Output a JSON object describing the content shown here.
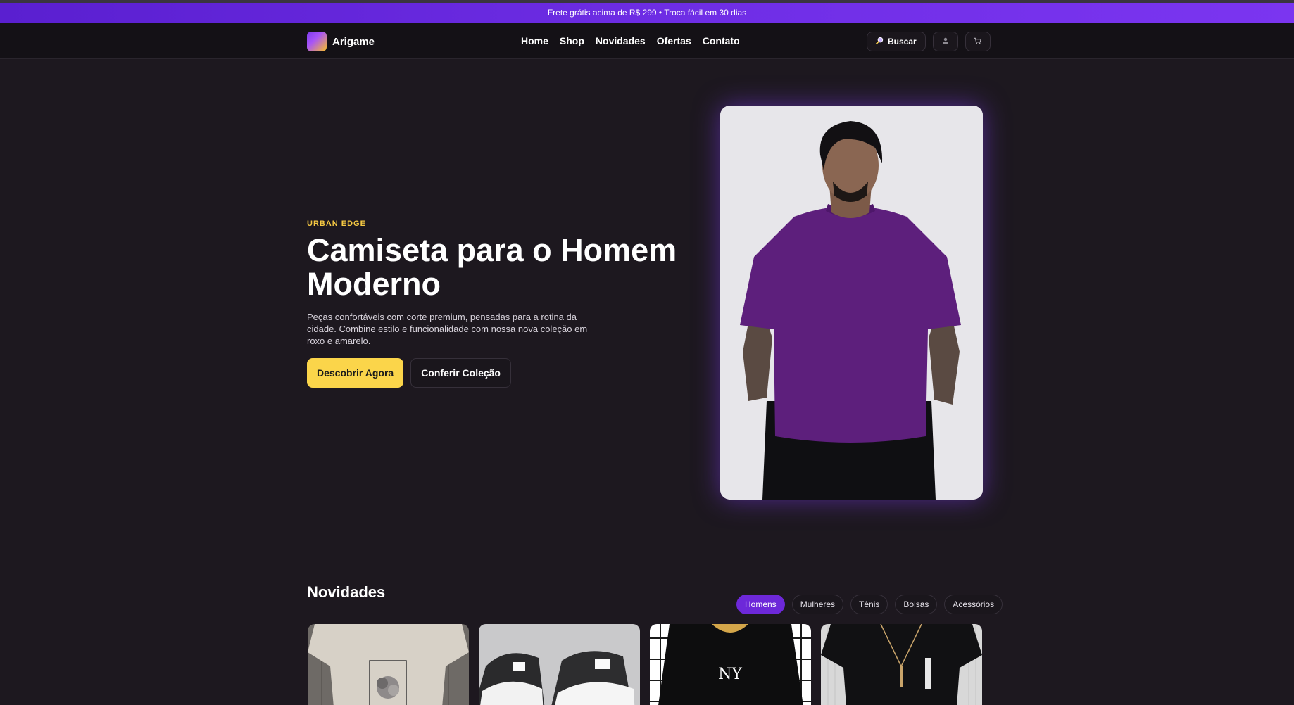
{
  "promo": {
    "text": "Frete grátis acima de R$ 299 • Troca fácil em 30 dias"
  },
  "brand": {
    "name": "Arigame"
  },
  "nav": {
    "links": [
      "Home",
      "Shop",
      "Novidades",
      "Ofertas",
      "Contato"
    ],
    "search_label": "Buscar",
    "icons": [
      "search-icon",
      "user-icon",
      "cart-icon"
    ]
  },
  "hero": {
    "eyebrow": "URBAN EDGE",
    "title": "Camiseta para o Homem Moderno",
    "description": "Peças confortáveis com corte premium, pensadas para a rotina da cidade. Combine estilo e funcionalidade com nossa nova coleção em roxo e amarelo.",
    "primary_cta": "Descobrir Agora",
    "secondary_cta": "Conferir Coleção"
  },
  "novidades": {
    "title": "Novidades",
    "filters": [
      "Homens",
      "Mulheres",
      "Tênis",
      "Bolsas",
      "Acessórios"
    ],
    "active_filter": "Homens"
  },
  "colors": {
    "accent_purple": "#6d28d9",
    "accent_yellow": "#fbd54a",
    "background": "#1d181f"
  }
}
